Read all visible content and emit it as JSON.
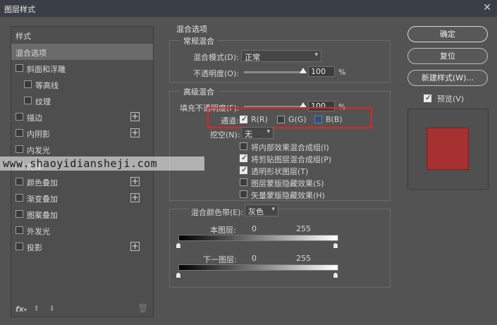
{
  "window": {
    "title": "图层样式",
    "close": "✕"
  },
  "left_panel": {
    "styles_header": "样式",
    "items": [
      {
        "label": "混合选项",
        "checkbox": false,
        "plus": false,
        "selected": true,
        "indent": false
      },
      {
        "label": "斜面和浮雕",
        "checkbox": true,
        "plus": false,
        "selected": false,
        "indent": false
      },
      {
        "label": "等高线",
        "checkbox": true,
        "plus": false,
        "selected": false,
        "indent": true
      },
      {
        "label": "纹理",
        "checkbox": true,
        "plus": false,
        "selected": false,
        "indent": true
      },
      {
        "label": "描边",
        "checkbox": true,
        "plus": true,
        "selected": false,
        "indent": false
      },
      {
        "label": "内阴影",
        "checkbox": true,
        "plus": true,
        "selected": false,
        "indent": false
      },
      {
        "label": "内发光",
        "checkbox": true,
        "plus": false,
        "selected": false,
        "indent": false
      },
      {
        "label": "光泽",
        "checkbox": true,
        "plus": false,
        "selected": false,
        "indent": false
      },
      {
        "label": "颜色叠加",
        "checkbox": true,
        "plus": true,
        "selected": false,
        "indent": false
      },
      {
        "label": "渐变叠加",
        "checkbox": true,
        "plus": true,
        "selected": false,
        "indent": false
      },
      {
        "label": "图案叠加",
        "checkbox": true,
        "plus": false,
        "selected": false,
        "indent": false
      },
      {
        "label": "外发光",
        "checkbox": true,
        "plus": false,
        "selected": false,
        "indent": false
      },
      {
        "label": "投影",
        "checkbox": true,
        "plus": true,
        "selected": false,
        "indent": false
      }
    ],
    "fx_label": "fx",
    "bottom_icons": [
      "fx-icon",
      "arrow-up-icon",
      "arrow-down-icon",
      "trash-icon"
    ]
  },
  "watermark": "www.shaoyidiansheji.com",
  "blend_options": {
    "title": "混合选项",
    "general": {
      "title": "常规混合",
      "mode_label": "混合模式(D):",
      "mode_value": "正常",
      "opacity_label": "不透明度(O):",
      "opacity_value": "100",
      "opacity_unit": "%"
    },
    "advanced": {
      "title": "高级混合",
      "fill_label": "填充不透明度(F):",
      "fill_value": "100",
      "fill_unit": "%",
      "channels_label": "通道:",
      "channels": [
        {
          "label": "R(R)",
          "checked": true
        },
        {
          "label": "G(G)",
          "checked": false
        },
        {
          "label": "B(B)",
          "checked": false
        }
      ],
      "knockout_label": "挖空(N):",
      "knockout_value": "无",
      "options": [
        {
          "label": "将内部效果混合成组(I)",
          "checked": false
        },
        {
          "label": "将剪贴图层混合成组(P)",
          "checked": true
        },
        {
          "label": "透明形状图层(T)",
          "checked": true
        },
        {
          "label": "图层蒙版隐藏效果(S)",
          "checked": false
        },
        {
          "label": "矢量蒙版隐藏效果(H)",
          "checked": false
        }
      ]
    },
    "blend_if": {
      "label": "混合颜色带(E):",
      "value": "灰色",
      "this_layer_label": "本图层:",
      "this_layer_min": "0",
      "this_layer_max": "255",
      "under_layer_label": "下一图层:",
      "under_layer_min": "0",
      "under_layer_max": "255"
    }
  },
  "buttons": {
    "ok": "确定",
    "reset": "复位",
    "new_style": "新建样式(W)...",
    "preview_label": "预览(V)",
    "preview_checked": true
  },
  "colors": {
    "preview_swatch": "#a73030",
    "highlight_box": "#e02424"
  }
}
